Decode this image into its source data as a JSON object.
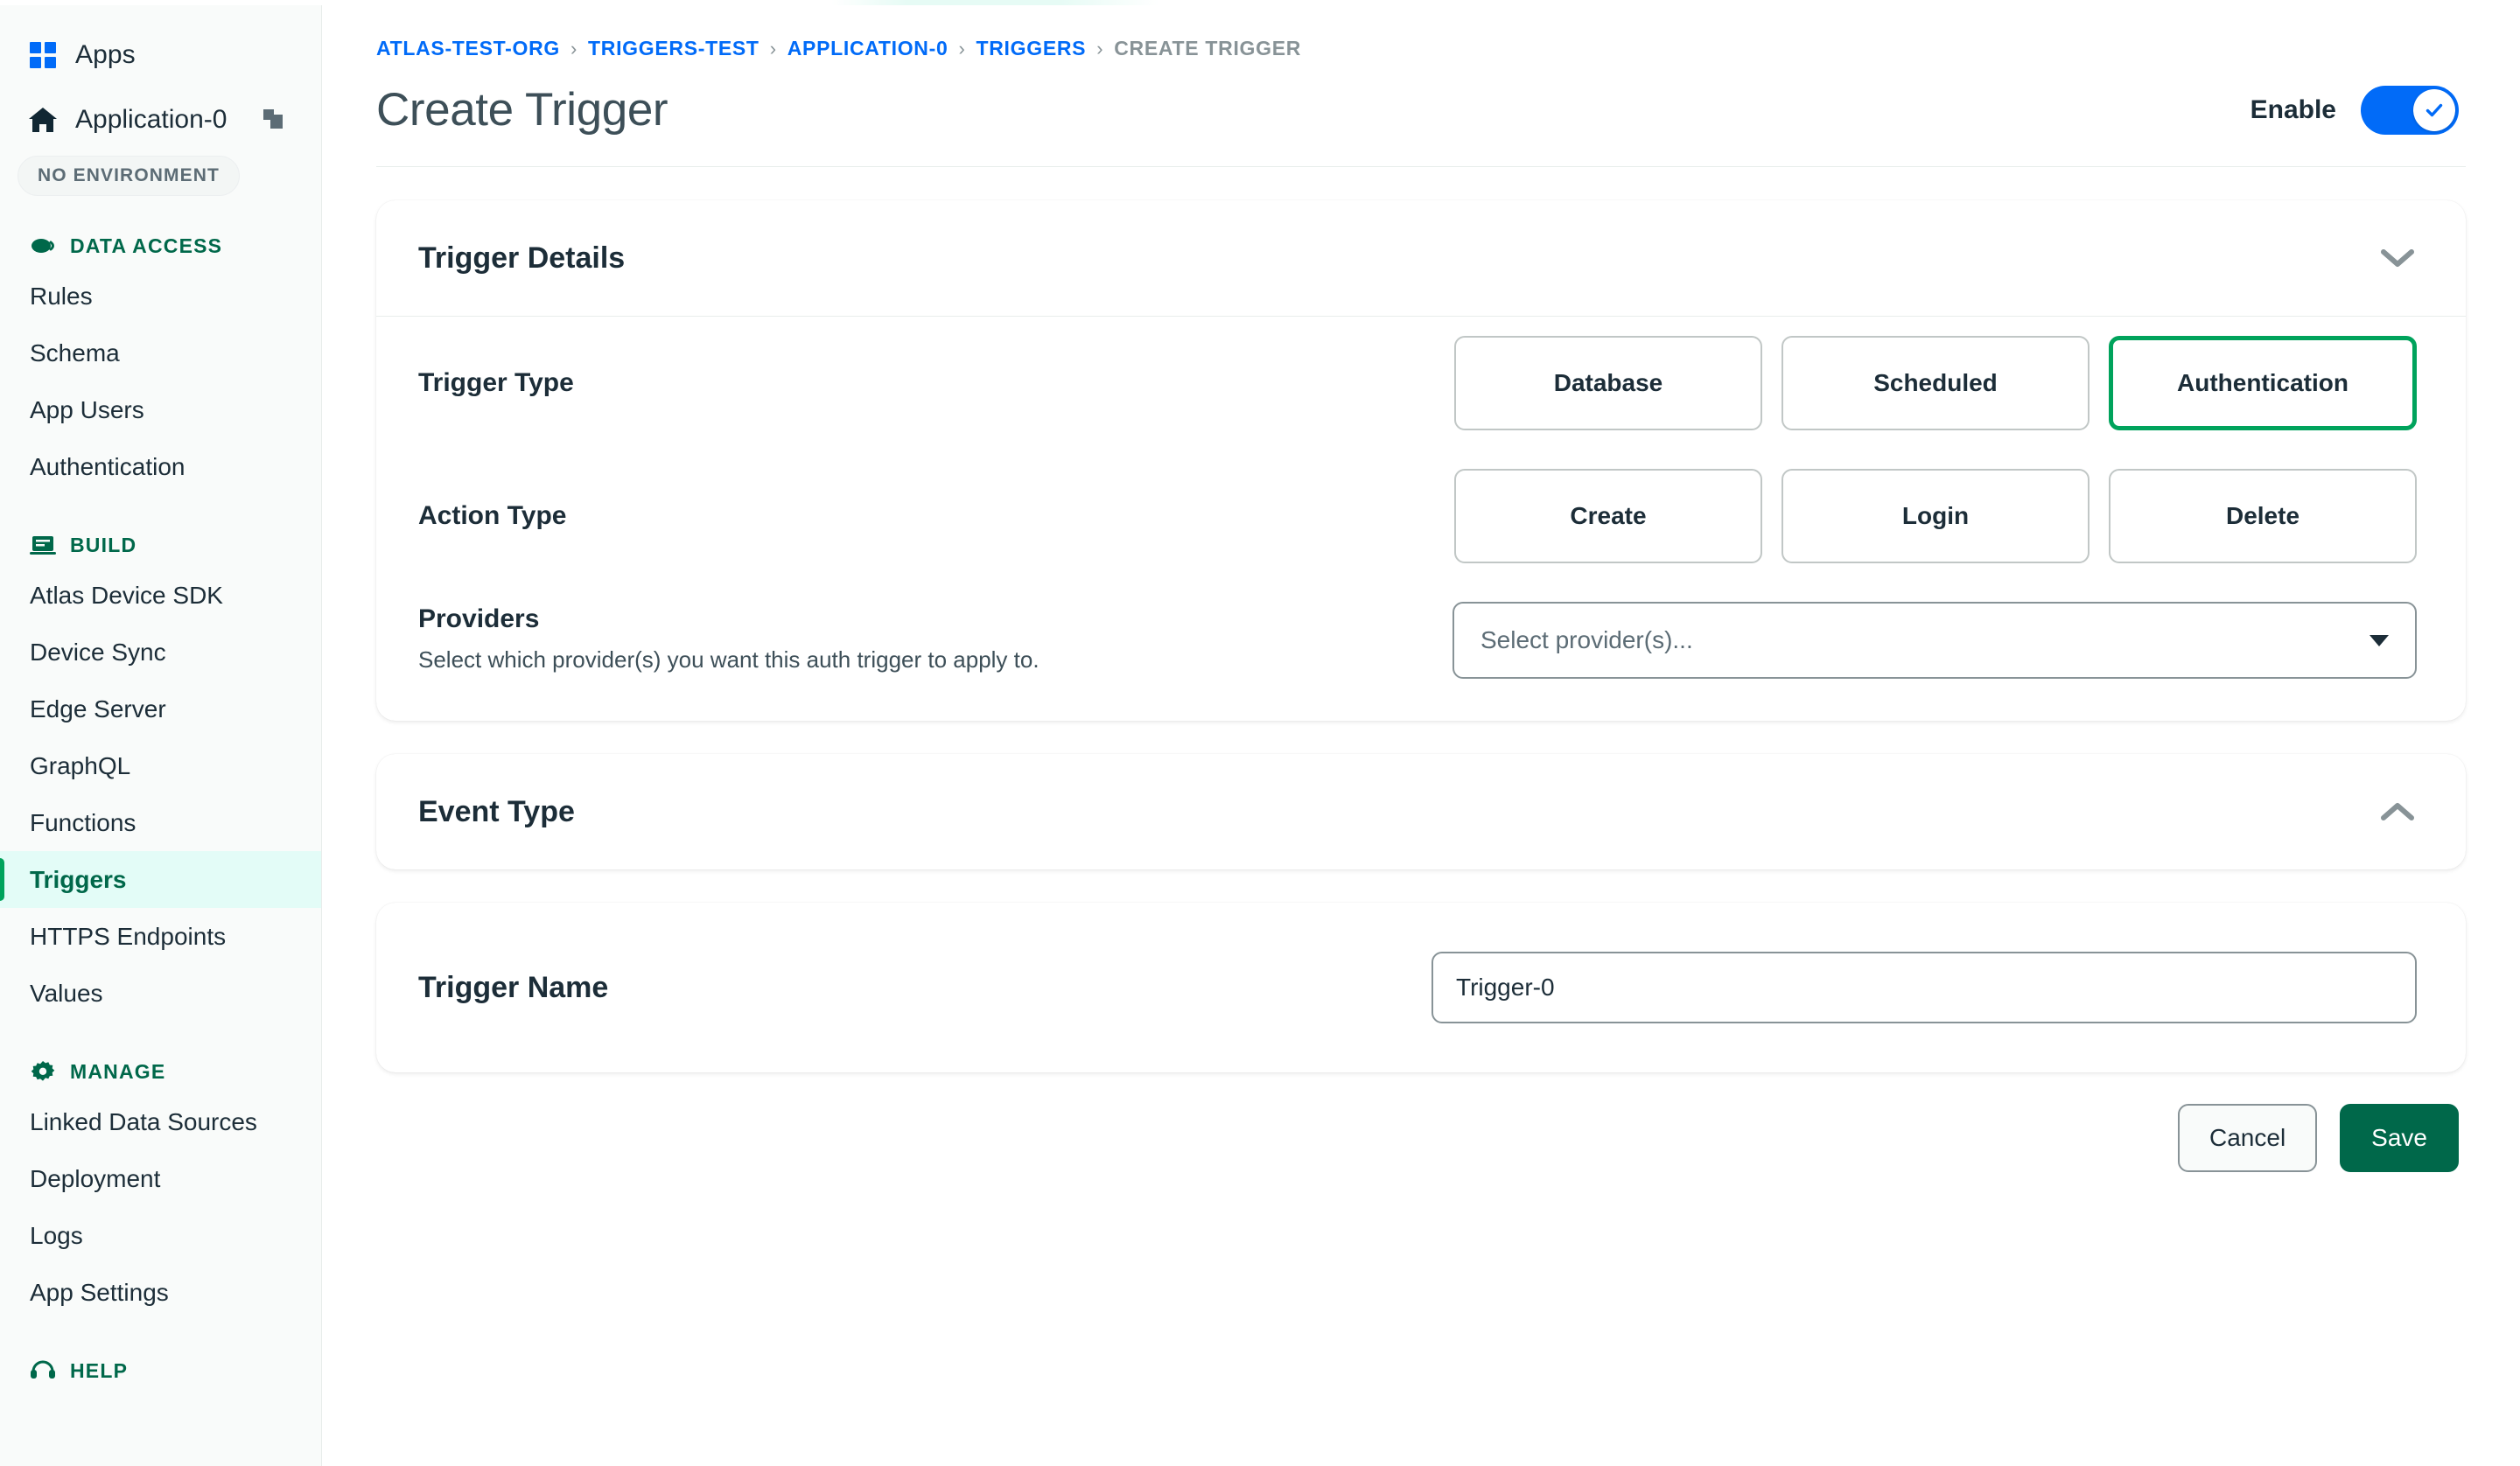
{
  "sidebar": {
    "apps_label": "Apps",
    "app_name": "Application-0",
    "environment_badge": "NO ENVIRONMENT",
    "sections": [
      {
        "icon": "cloud-icon",
        "label": "DATA ACCESS",
        "items": [
          {
            "label": "Rules",
            "active": false
          },
          {
            "label": "Schema",
            "active": false
          },
          {
            "label": "App Users",
            "active": false
          },
          {
            "label": "Authentication",
            "active": false
          }
        ]
      },
      {
        "icon": "laptop-icon",
        "label": "BUILD",
        "items": [
          {
            "label": "Atlas Device SDK",
            "active": false
          },
          {
            "label": "Device Sync",
            "active": false
          },
          {
            "label": "Edge Server",
            "active": false
          },
          {
            "label": "GraphQL",
            "active": false
          },
          {
            "label": "Functions",
            "active": false
          },
          {
            "label": "Triggers",
            "active": true
          },
          {
            "label": "HTTPS Endpoints",
            "active": false
          },
          {
            "label": "Values",
            "active": false
          }
        ]
      },
      {
        "icon": "gear-icon",
        "label": "MANAGE",
        "items": [
          {
            "label": "Linked Data Sources",
            "active": false
          },
          {
            "label": "Deployment",
            "active": false
          },
          {
            "label": "Logs",
            "active": false
          },
          {
            "label": "App Settings",
            "active": false
          }
        ]
      },
      {
        "icon": "support-icon",
        "label": "HELP",
        "items": []
      }
    ]
  },
  "breadcrumb": {
    "items": [
      {
        "label": "ATLAS-TEST-ORG",
        "current": false
      },
      {
        "label": "TRIGGERS-TEST",
        "current": false
      },
      {
        "label": "APPLICATION-0",
        "current": false
      },
      {
        "label": "TRIGGERS",
        "current": false
      },
      {
        "label": "CREATE TRIGGER",
        "current": true
      }
    ],
    "separator": "›"
  },
  "header": {
    "title": "Create Trigger",
    "enable_label": "Enable",
    "enable_on": true
  },
  "trigger_details": {
    "title": "Trigger Details",
    "collapse_icon": "chevron-down-icon",
    "trigger_type": {
      "label": "Trigger Type",
      "options": [
        "Database",
        "Scheduled",
        "Authentication"
      ],
      "selected": "Authentication"
    },
    "action_type": {
      "label": "Action Type",
      "options": [
        "Create",
        "Login",
        "Delete"
      ],
      "selected": ""
    },
    "providers": {
      "label": "Providers",
      "description": "Select which provider(s) you want this auth trigger to apply to.",
      "placeholder": "Select provider(s)...",
      "value": "",
      "caret_icon": "caret-down-icon"
    }
  },
  "event_type": {
    "title": "Event Type",
    "collapse_icon": "chevron-up-icon"
  },
  "trigger_name": {
    "label": "Trigger Name",
    "value": "Trigger-0",
    "placeholder": "Trigger-0"
  },
  "footer": {
    "cancel_label": "Cancel",
    "save_label": "Save"
  },
  "colors": {
    "accent_green": "#00684A",
    "selected_green": "#00A35C",
    "link_blue": "#016BF8",
    "active_nav_bg": "#e3fcf7",
    "muted": "#889397"
  }
}
